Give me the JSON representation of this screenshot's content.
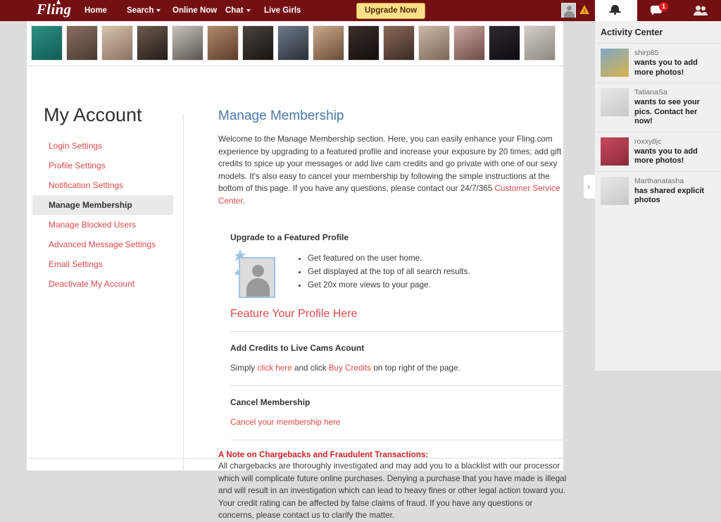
{
  "header": {
    "logo": "Fling",
    "nav": [
      {
        "label": "Home",
        "has_caret": false
      },
      {
        "label": "Search",
        "has_caret": true
      },
      {
        "label": "Online Now",
        "has_caret": false
      },
      {
        "label": "Chat",
        "has_caret": true
      },
      {
        "label": "Live Girls",
        "has_caret": false
      }
    ],
    "upgrade_button": "Upgrade Now",
    "message_badge": "1",
    "colors": {
      "bar": "#731013",
      "upgrade_bg": "#fbe08a",
      "badge": "#e01b1b"
    }
  },
  "thumbnail_strip": {
    "count": 15,
    "thumbs": [
      {
        "c1": "#2f8f84",
        "c2": "#0f5d57"
      },
      {
        "c1": "#8a6f60",
        "c2": "#4a3a30"
      },
      {
        "c1": "#d8c3ae",
        "c2": "#8a7360"
      },
      {
        "c1": "#6b5a4e",
        "c2": "#241d18"
      },
      {
        "c1": "#c9c3bd",
        "c2": "#5a5550"
      },
      {
        "c1": "#b08a6a",
        "c2": "#5e3c2a"
      },
      {
        "c1": "#4a4440",
        "c2": "#16130f"
      },
      {
        "c1": "#6e7a88",
        "c2": "#2a3038"
      },
      {
        "c1": "#caa98c",
        "c2": "#6b4c36"
      },
      {
        "c1": "#3b2f2a",
        "c2": "#120e0c"
      },
      {
        "c1": "#8c6a58",
        "c2": "#3a2a22"
      },
      {
        "c1": "#cdb9a6",
        "c2": "#7a6654"
      },
      {
        "c1": "#c9a8a0",
        "c2": "#6d4a44"
      },
      {
        "c1": "#2e2a30",
        "c2": "#0d0b10"
      },
      {
        "c1": "#d2cdc6",
        "c2": "#8d8880"
      }
    ]
  },
  "sidebar": {
    "title": "My Account",
    "items": [
      {
        "label": "Login Settings",
        "active": false
      },
      {
        "label": "Profile Settings",
        "active": false
      },
      {
        "label": "Notification Settings",
        "active": false
      },
      {
        "label": "Manage Membership",
        "active": true
      },
      {
        "label": "Manage Blocked Users",
        "active": false
      },
      {
        "label": "Advanced Message Settings",
        "active": false
      },
      {
        "label": "Email Settings",
        "active": false
      },
      {
        "label": "Deactivate My Account",
        "active": false
      }
    ]
  },
  "main": {
    "title": "Manage Membership",
    "intro_text": "Welcome to the Manage Membership section. Here, you can easily enhance your Fling.com experience by upgrading to a featured profile and increase your exposure by 20 times; add gift credits to spice up your messages or add live cam credits and go private with one of our sexy models. It's also easy to cancel your membership by following the simple instructions at the bottom of this page. If you have any questions, please contact our 24/7/365 ",
    "intro_link": "Customer Service Center",
    "intro_tail": ".",
    "featured": {
      "heading": "Upgrade to a Featured Profile",
      "benefits": [
        "Get featured on the user home.",
        "Get displayed at the top of all search results.",
        "Get 20x more views to your page."
      ],
      "link": "Feature Your Profile Here"
    },
    "credits": {
      "heading": "Add Credits to Live Cams Acount",
      "line_start": "Simply ",
      "link1": "click here",
      "line_middle": " and click ",
      "link2": "Buy Credits",
      "line_end": " on top right of the page."
    },
    "cancel": {
      "heading": "Cancel Membership",
      "link": "Cancel your membership here"
    },
    "chargeback": {
      "heading": "A Note on Chargebacks and Fraudulent Transactions:",
      "body": "All chargebacks are thoroughly investigated and may add you to a blacklist with our processor which will complicate future online purchases. Denying a purchase that you have made is illegal and will result in an investigation which can lead to heavy fines or other legal action toward you. Your credit rating can be affected by false claims of fraud. If you have any questions or concerns, please contact us to clarify the matter."
    }
  },
  "activity_center": {
    "title": "Activity Center",
    "toggle_icon": "›",
    "items": [
      {
        "user": "shirp85",
        "message": "wants you to add more photos!",
        "c1": "#7fa8c8",
        "c2": "#d8b24a"
      },
      {
        "user": "TatianaSa",
        "message": "wants to see your pics. Contact her now!",
        "c1": "#e8e8e8",
        "c2": "#c8c8c8"
      },
      {
        "user": "roxxy8jc",
        "message": "wants you to add more photos!",
        "c1": "#c94a5e",
        "c2": "#8a2a3a"
      },
      {
        "user": "Marthanatasha",
        "message": "has shared explicit photos",
        "c1": "#e8e8e8",
        "c2": "#c8c8c8"
      }
    ]
  }
}
